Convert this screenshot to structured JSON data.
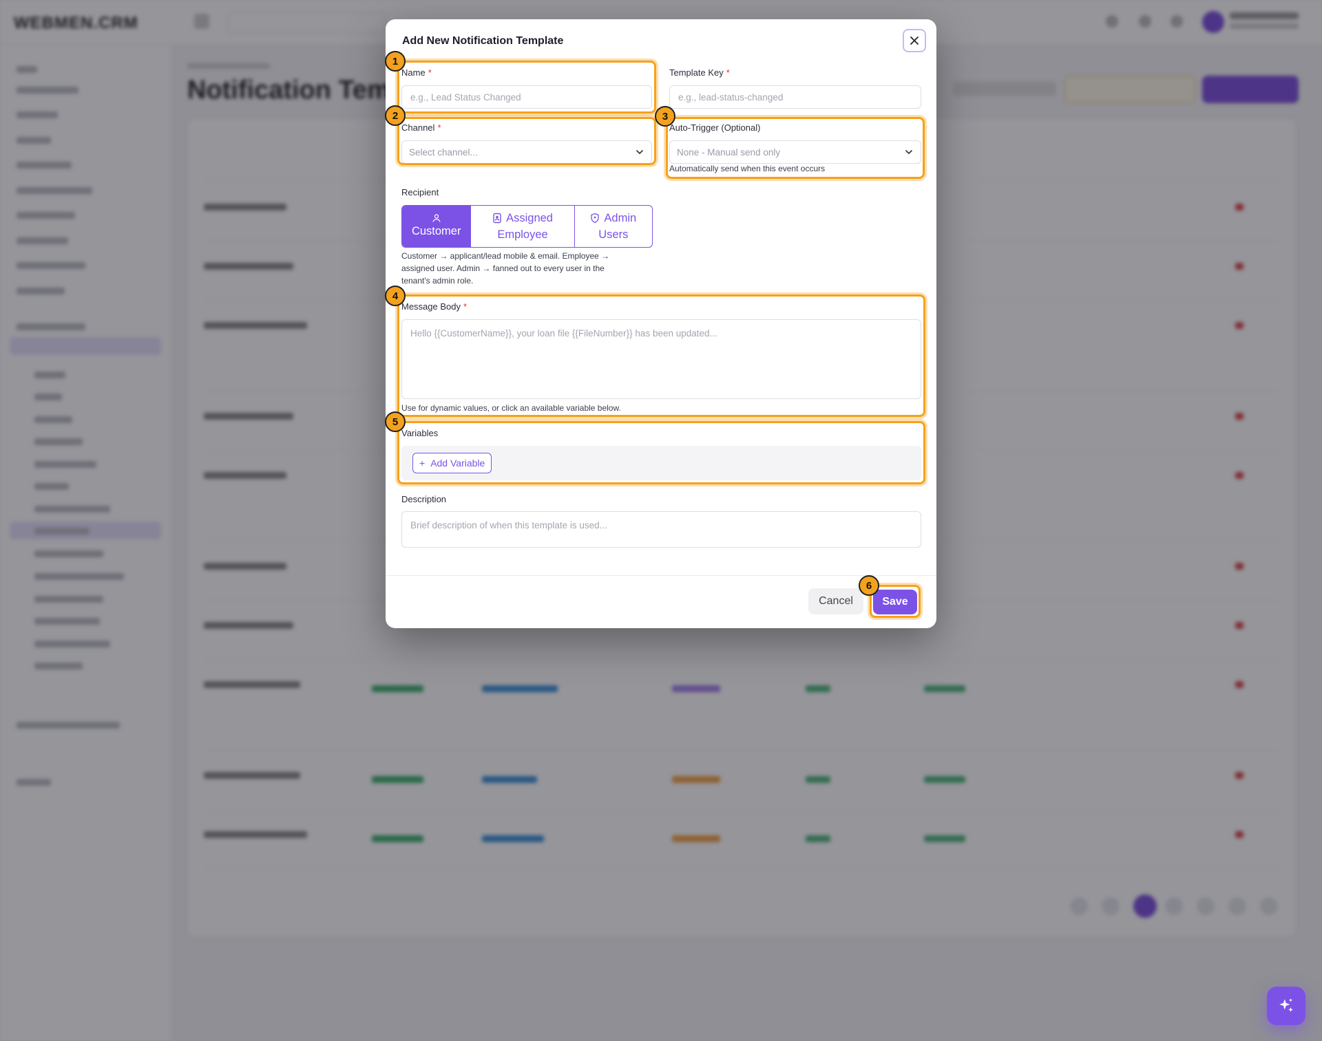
{
  "background": {
    "logo": "WEBMEN.CRM",
    "page_title": "Notification Templates"
  },
  "modal": {
    "title": "Add New Notification Template",
    "name": {
      "label": "Name",
      "placeholder": "e.g., Lead Status Changed"
    },
    "template_key": {
      "label": "Template Key",
      "placeholder": "e.g., lead-status-changed"
    },
    "channel": {
      "label": "Channel",
      "value": "Select channel..."
    },
    "auto_trigger": {
      "label": "Auto-Trigger (Optional)",
      "value": "None - Manual send only",
      "helper": "Automatically send when this event occurs"
    },
    "recipient": {
      "label": "Recipient",
      "options": [
        {
          "icon": "user-icon",
          "line1": "Customer",
          "line2": ""
        },
        {
          "icon": "badge-icon",
          "line1": "Assigned",
          "line2": "Employee"
        },
        {
          "icon": "shield-icon",
          "line1": "Admin",
          "line2": "Users"
        }
      ],
      "selected": "Customer",
      "helper": "Customer → applicant/lead mobile & email. Employee → assigned user. Admin → fanned out to every user in the tenant's admin role."
    },
    "message_body": {
      "label": "Message Body",
      "placeholder": "Hello {{CustomerName}}, your loan file {{FileNumber}} has been updated...",
      "helper": "Use for dynamic values, or click an available variable below."
    },
    "variables": {
      "label": "Variables",
      "add_button": "Add Variable"
    },
    "description": {
      "label": "Description",
      "placeholder": "Brief description of when this template is used..."
    },
    "cancel_label": "Cancel",
    "save_label": "Save"
  },
  "annotations": [
    "1",
    "2",
    "3",
    "4",
    "5",
    "6"
  ],
  "colors": {
    "accent": "#7c52e6",
    "highlight": "#f6a11a",
    "required": "#e03131"
  }
}
